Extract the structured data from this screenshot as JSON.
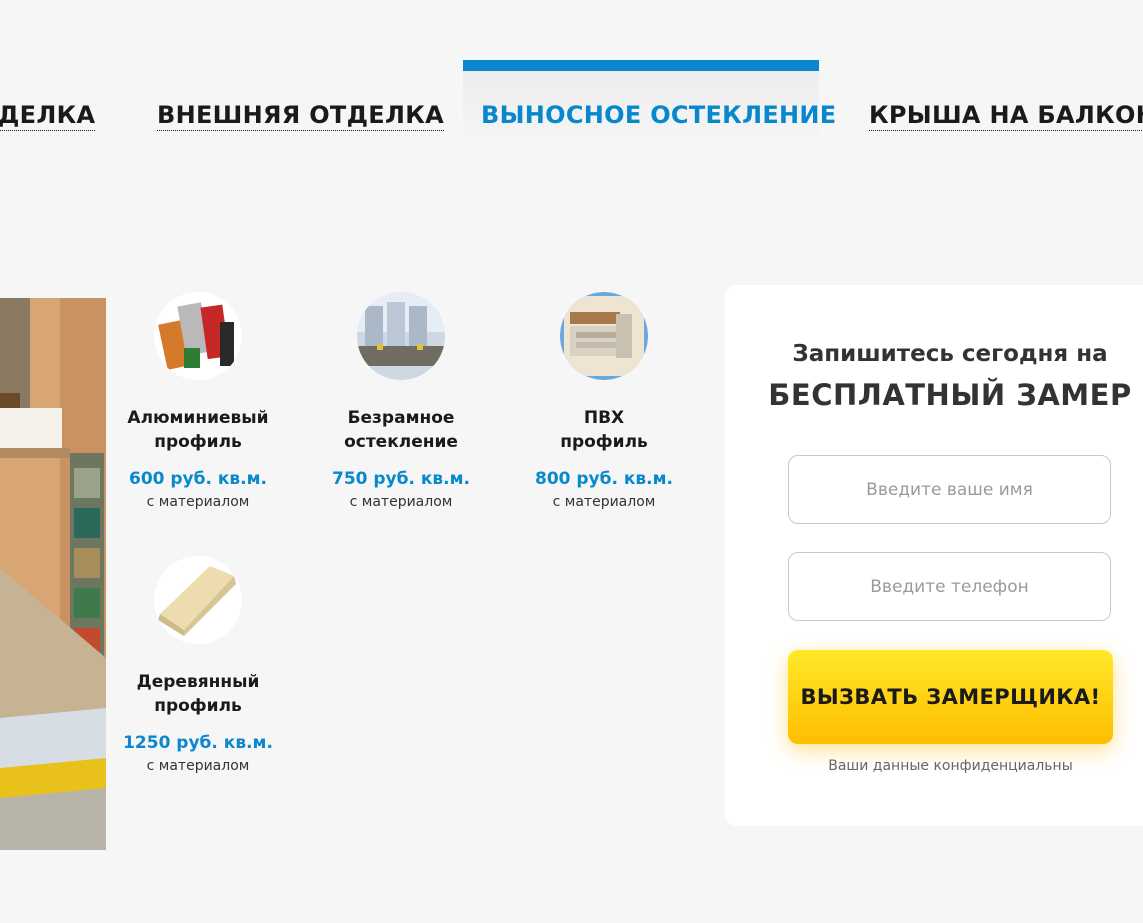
{
  "tabs": [
    {
      "label": "ДЕЛКА",
      "active": false
    },
    {
      "label": "ВНЕШНЯЯ ОТДЕЛКА",
      "active": false
    },
    {
      "label": "ВЫНОСНОЕ ОСТЕКЛЕНИЕ",
      "active": true
    },
    {
      "label": "КРЫША НА БАЛКОН",
      "active": false
    }
  ],
  "products": [
    {
      "icon": "aluminium-profile-icon",
      "name_line1": "Алюминиевый",
      "name_line2": "профиль",
      "price": "600 руб. кв.м.",
      "note": "с материалом"
    },
    {
      "icon": "frameless-glazing-icon",
      "name_line1": "Безрамное",
      "name_line2": "остекление",
      "price": "750 руб. кв.м.",
      "note": "с материалом"
    },
    {
      "icon": "pvc-profile-icon",
      "name_line1": "ПВХ",
      "name_line2": "профиль",
      "price": "800 руб. кв.м.",
      "note": "с материалом"
    },
    {
      "icon": "wooden-profile-icon",
      "name_line1": "Деревянный",
      "name_line2": "профиль",
      "price": "1250 руб. кв.м.",
      "note": "с материалом"
    }
  ],
  "form": {
    "title_line1": "Запишитесь сегодня на",
    "title_line2": "БЕСПЛАТНЫЙ ЗАМЕР",
    "name_placeholder": "Введите ваше имя",
    "phone_placeholder": "Введите телефон",
    "submit_label": "ВЫЗВАТЬ ЗАМЕРЩИКА!",
    "privacy_note": "Ваши данные конфиденциальны"
  },
  "colors": {
    "accent_blue": "#0987cc",
    "cta_yellow": "#ffd000",
    "background": "#f6f6f6"
  }
}
